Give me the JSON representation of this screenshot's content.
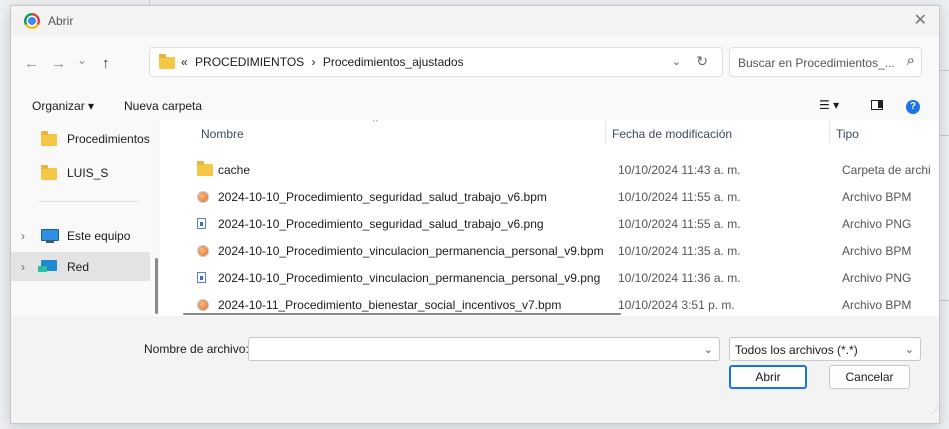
{
  "window": {
    "title": "Abrir",
    "close_glyph": "✕"
  },
  "nav": {
    "back_glyph": "←",
    "forward_glyph": "→",
    "recent_glyph": "⌄",
    "up_glyph": "↑"
  },
  "address": {
    "overflow": "«",
    "crumbs": [
      "PROCEDIMIENTOS",
      "›",
      "Procedimientos_ajustados"
    ],
    "refresh_glyph": "↻",
    "dropdown_glyph": "⌄"
  },
  "search": {
    "placeholder": "Buscar en Procedimientos_...",
    "icon": "search-icon"
  },
  "toolbar": {
    "organize_label": "Organizar ▾",
    "new_folder_label": "Nueva carpeta",
    "view_glyph": "☰ ▾",
    "help_glyph": "?"
  },
  "sidebar": {
    "items": [
      {
        "label": "Procedimientos",
        "icon": "folder-icon"
      },
      {
        "label": "LUIS_S",
        "icon": "folder-icon"
      },
      {
        "label": "Este equipo",
        "icon": "computer-icon",
        "chevron": "›"
      },
      {
        "label": "Red",
        "icon": "network-icon",
        "chevron": "›",
        "selected": true
      }
    ]
  },
  "columns": {
    "name": "Nombre",
    "date": "Fecha de modificación",
    "type": "Tipo",
    "sort_glyph": "^"
  },
  "files": [
    {
      "name": "cache",
      "date": "10/10/2024 11:43 a. m.",
      "type": "Carpeta de archi",
      "icon": "folder"
    },
    {
      "name": "2024-10-10_Procedimiento_seguridad_salud_trabajo_v6.bpm",
      "date": "10/10/2024 11:55 a. m.",
      "type": "Archivo BPM",
      "icon": "bpm"
    },
    {
      "name": "2024-10-10_Procedimiento_seguridad_salud_trabajo_v6.png",
      "date": "10/10/2024 11:55 a. m.",
      "type": "Archivo PNG",
      "icon": "png"
    },
    {
      "name": "2024-10-10_Procedimiento_vinculacion_permanencia_personal_v9.bpm",
      "date": "10/10/2024 11:35 a. m.",
      "type": "Archivo BPM",
      "icon": "bpm"
    },
    {
      "name": "2024-10-10_Procedimiento_vinculacion_permanencia_personal_v9.png",
      "date": "10/10/2024 11:36 a. m.",
      "type": "Archivo PNG",
      "icon": "png"
    },
    {
      "name": "2024-10-11_Procedimiento_bienestar_social_incentivos_v7.bpm",
      "date": "10/10/2024 3:51 p. m.",
      "type": "Archivo BPM",
      "icon": "bpm"
    }
  ],
  "footer": {
    "filename_label": "Nombre de archivo:",
    "filename_value": "",
    "filetype_value": "Todos los archivos (*.*)",
    "open_label": "Abrir",
    "cancel_label": "Cancelar"
  },
  "colors": {
    "accent": "#1a73e8",
    "folder": "#f6c744",
    "selection": "#cce4f7"
  }
}
